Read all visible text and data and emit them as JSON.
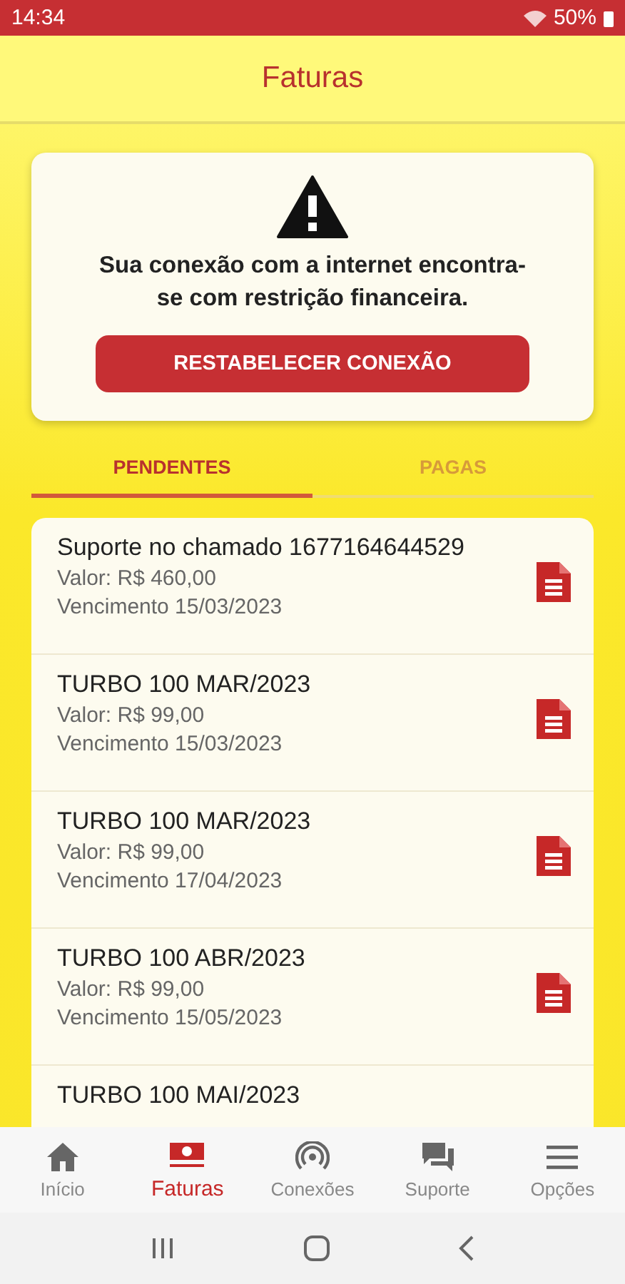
{
  "status_bar": {
    "time": "14:34",
    "battery": "50%"
  },
  "header": {
    "title": "Faturas"
  },
  "alert": {
    "message": "Sua conexão com a internet encontra-se com restrição financeira.",
    "button": "RESTABELECER CONEXÃO"
  },
  "tabs": [
    {
      "label": "PENDENTES",
      "selected": true
    },
    {
      "label": "PAGAS",
      "selected": false
    }
  ],
  "invoices": [
    {
      "title": "Suporte no chamado 1677164644529",
      "value": "Valor: R$ 460,00",
      "due": "Vencimento 15/03/2023"
    },
    {
      "title": "TURBO 100 MAR/2023",
      "value": "Valor: R$ 99,00",
      "due": "Vencimento 15/03/2023"
    },
    {
      "title": "TURBO 100 MAR/2023",
      "value": "Valor: R$ 99,00",
      "due": "Vencimento 17/04/2023"
    },
    {
      "title": "TURBO 100 ABR/2023",
      "value": "Valor: R$ 99,00",
      "due": "Vencimento 15/05/2023"
    },
    {
      "title": "TURBO 100 MAI/2023"
    }
  ],
  "bottom_nav": [
    {
      "label": "Início",
      "kind": "home",
      "selected": false
    },
    {
      "label": "Faturas",
      "kind": "invoice",
      "selected": true
    },
    {
      "label": "Conexões",
      "kind": "signal",
      "selected": false
    },
    {
      "label": "Suporte",
      "kind": "chat",
      "selected": false
    },
    {
      "label": "Opções",
      "kind": "menu",
      "selected": false
    }
  ]
}
